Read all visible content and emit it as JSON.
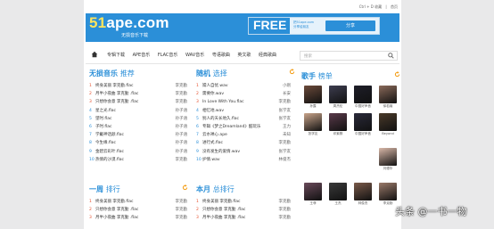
{
  "topbar": {
    "links": [
      "Ctrl + D 收藏",
      "|",
      "首页"
    ]
  },
  "banner": {
    "logo_prefix": "51",
    "logo_rest": "ape.com",
    "slogan": "无损音乐下载",
    "free": "FREE",
    "free_sub1": "把51ape.com",
    "free_sub2": "分享给朋友",
    "share": "分享"
  },
  "nav": {
    "items": [
      "专辑下载",
      "APE音乐",
      "FLAC音乐",
      "WAV音乐",
      "粤语歌曲",
      "英文歌",
      "经典歌曲"
    ],
    "search_placeholder": "搜索"
  },
  "sections": {
    "lossless": {
      "title_a": "无损音乐",
      "title_b": "推荐",
      "items": [
        {
          "n": "1",
          "t": "终身美丽 李克勤.flac",
          "a": "李克勤"
        },
        {
          "n": "2",
          "t": "月半小夜曲 李克勤 .flac",
          "a": "李克勤"
        },
        {
          "n": "3",
          "t": "只想你会意 李克勤 .flac",
          "a": "李克勤"
        },
        {
          "n": "4",
          "t": "星之光.flac",
          "a": "孙子涵"
        },
        {
          "n": "5",
          "t": "望时.flac",
          "a": "孙子涵"
        },
        {
          "n": "6",
          "t": "子时.flac",
          "a": "孙子涵"
        },
        {
          "n": "7",
          "t": "学戴神话颜.flac",
          "a": "孙子涵"
        },
        {
          "n": "8",
          "t": "今生缘.flac",
          "a": "孙子涵"
        },
        {
          "n": "9",
          "t": "金碧云彩叶.flac",
          "a": "孙子涵"
        },
        {
          "n": "10",
          "t": "热情的沙漠.flac",
          "a": "李克勤"
        }
      ]
    },
    "random": {
      "title_a": "随机",
      "title_b": "选择",
      "items": [
        {
          "n": "1",
          "t": "嫦人自忧.wav",
          "a": "小刚"
        },
        {
          "n": "2",
          "t": "需要你.wav",
          "a": "长安"
        },
        {
          "n": "3",
          "t": "In Love With You.flac",
          "a": "李克勤"
        },
        {
          "n": "4",
          "t": "相忆地.wav",
          "a": "张学友"
        },
        {
          "n": "5",
          "t": "别人的天长地久.flac",
          "a": "张学友"
        },
        {
          "n": "6",
          "t": "专辑《梦之Dreamland》酷玩乐",
          "a": "王力"
        },
        {
          "n": "7",
          "t": "云水禅心.ape",
          "a": "未知"
        },
        {
          "n": "8",
          "t": "进行式.flac",
          "a": "李克勤"
        },
        {
          "n": "9",
          "t": "没有发生的爱情.wav",
          "a": "张学友"
        },
        {
          "n": "10",
          "t": "护情.wav",
          "a": "林俊杰"
        }
      ]
    },
    "week": {
      "title_a": "一周",
      "title_b": "排行",
      "items": [
        {
          "n": "1",
          "t": "终身美丽 李克勤.flac",
          "a": "李克勤"
        },
        {
          "n": "2",
          "t": "只想你会意 李克勤 .flac",
          "a": "李克勤"
        },
        {
          "n": "3",
          "t": "月半小夜曲 李克勤 .flac",
          "a": "李克勤"
        }
      ]
    },
    "month": {
      "title_a": "本月",
      "title_b": "总排行",
      "items": [
        {
          "n": "1",
          "t": "终身美丽 李克勤.flac",
          "a": "李克勤"
        },
        {
          "n": "2",
          "t": "只想你会意 李克勤 .flac",
          "a": "李克勤"
        },
        {
          "n": "3",
          "t": "月半小夜曲 李克勤 .flac",
          "a": "李克勤"
        }
      ]
    }
  },
  "singers": {
    "title_a": "歌手",
    "title_b": "榜单",
    "row1": [
      "孙露",
      "周杰伦",
      "中国好声音",
      "徐若瑄"
    ],
    "row2": [
      "张学友",
      "邓紫棋",
      "中国好声音",
      "Beyond"
    ],
    "row3": [
      "刘德华"
    ],
    "row4": [
      "王菲",
      "王杰",
      "林俊杰",
      "李克勤"
    ]
  },
  "watermark": "头条 @一书一物",
  "colors": {
    "accent": "#2b8fd8",
    "rank_red": "#e6502e",
    "refresh": "#f39c12"
  }
}
